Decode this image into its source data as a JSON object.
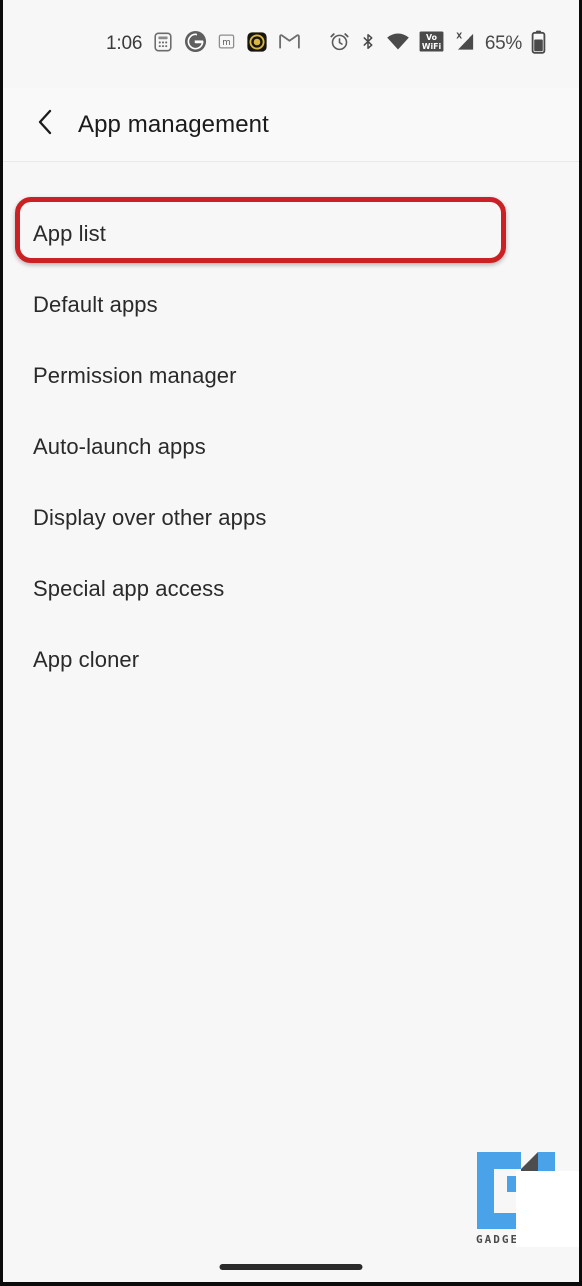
{
  "statusbar": {
    "time": "1:06",
    "battery_percent": "65%",
    "left_icons": [
      {
        "name": "calculator-icon",
        "label": "Calculator"
      },
      {
        "name": "google-icon",
        "label": "Google"
      },
      {
        "name": "mastodon-icon",
        "label": "Mastodon"
      },
      {
        "name": "badge-app-icon",
        "label": "App notification"
      },
      {
        "name": "gmail-icon",
        "label": "Gmail"
      }
    ],
    "right_icons": [
      {
        "name": "alarm-clock-icon",
        "label": "Alarm set"
      },
      {
        "name": "bluetooth-icon",
        "label": "Bluetooth"
      },
      {
        "name": "wifi-icon",
        "label": "Wi-Fi"
      },
      {
        "name": "volte-wifi-icon",
        "label": "VoWiFi"
      },
      {
        "name": "cellular-signal-icon",
        "label": "No SIM signal"
      },
      {
        "name": "battery-icon",
        "label": "Battery"
      }
    ]
  },
  "header": {
    "back_icon": "chevron-left-icon",
    "title": "App management"
  },
  "list": {
    "items": [
      {
        "label": "App list",
        "highlighted": true
      },
      {
        "label": "Default apps",
        "highlighted": false
      },
      {
        "label": "Permission manager",
        "highlighted": false
      },
      {
        "label": "Auto-launch apps",
        "highlighted": false
      },
      {
        "label": "Display over other apps",
        "highlighted": false
      },
      {
        "label": "Special app access",
        "highlighted": false
      },
      {
        "label": "App cloner",
        "highlighted": false
      }
    ]
  },
  "watermark": {
    "text": "GADGETSTOUSE",
    "logo_name": "gu-logo-icon"
  },
  "colors": {
    "highlight_red": "#cc2124",
    "background": "#f7f7f7",
    "header_background": "#f9f9f9",
    "text_primary": "#2a2a2a",
    "logo_blue": "#4aa3e8",
    "logo_dark": "#4a4a4a"
  },
  "navbar": {
    "home_indicator": "home-indicator"
  }
}
